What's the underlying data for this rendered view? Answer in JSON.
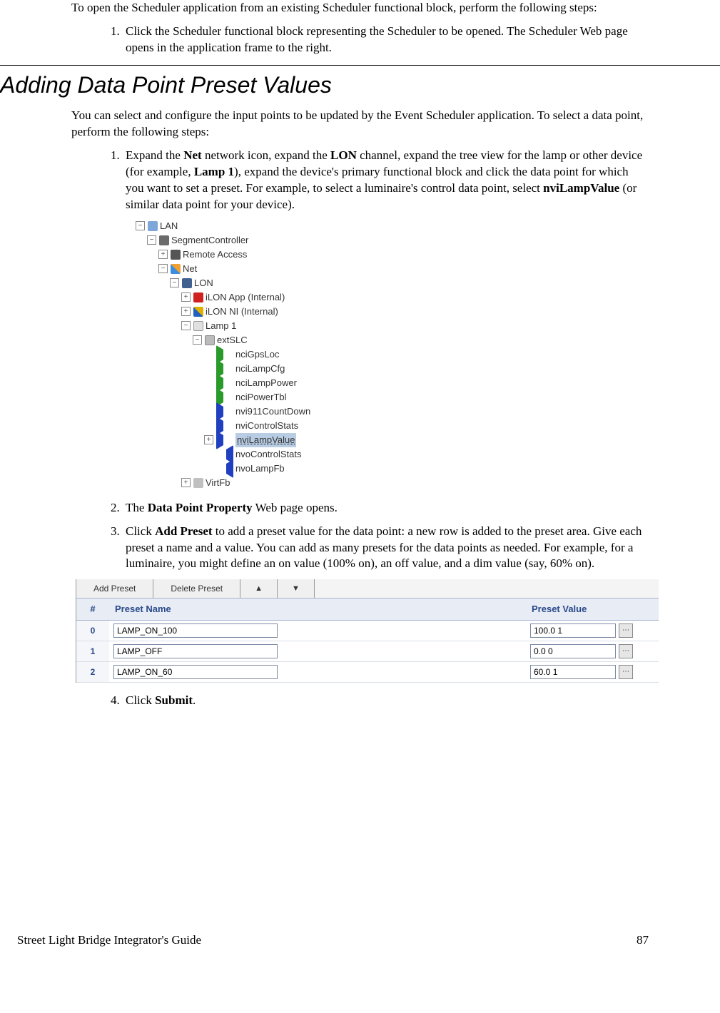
{
  "intro": {
    "p1": "To open the Scheduler application from an existing Scheduler functional block, perform the following steps:",
    "step1": "Click the Scheduler functional block representing the Scheduler to be opened.  The Scheduler Web page opens in the application frame to the right."
  },
  "section_title": "Adding Data Point Preset Values",
  "adding": {
    "p1": "You can select and configure the input points to be updated by the Event Scheduler application.  To select a data point, perform the following steps:",
    "step1": {
      "pre": "Expand the ",
      "b1": "Net",
      "mid1": " network icon, expand the ",
      "b2": "LON",
      "mid2": " channel, expand the tree view for the lamp or other device (for example, ",
      "b3": "Lamp 1",
      "mid3": "), expand the device's primary functional block and click the data point for which you want to set a preset.  For example, to select a luminaire's control data point, select ",
      "b4": "nviLampValue",
      "post": " (or similar data point for your device)."
    },
    "step2": {
      "pre": "The ",
      "b": "Data Point Property",
      "post": " Web page opens."
    },
    "step3": {
      "pre": "Click ",
      "b": "Add Preset",
      "post": " to add a preset value for the data point:  a new row is added to the preset area.  Give each preset a name and a value.  You can add as many presets for the data points as needed.  For example, for a luminaire, you might define an on value (100% on), an off value, and a dim value (say, 60% on)."
    },
    "step4": {
      "pre": "Click ",
      "b": "Submit",
      "post": "."
    }
  },
  "tree": {
    "lan": "LAN",
    "seg": "SegmentController",
    "rem": "Remote Access",
    "net": "Net",
    "lon": "LON",
    "app": "iLON App (Internal)",
    "ni": "iLON NI (Internal)",
    "lamp": "Lamp 1",
    "ext": "extSLC",
    "pts": [
      {
        "n": "nciGpsLoc",
        "c": "nci"
      },
      {
        "n": "nciLampCfg",
        "c": "nci"
      },
      {
        "n": "nciLampPower",
        "c": "nci"
      },
      {
        "n": "nciPowerTbl",
        "c": "nci"
      },
      {
        "n": "nvi911CountDown",
        "c": "nvi"
      },
      {
        "n": "nviControlStats",
        "c": "nvi"
      },
      {
        "n": "nviLampValue",
        "c": "nvi",
        "sel": true,
        "pm": "+"
      },
      {
        "n": "nvoControlStats",
        "c": "nvo"
      },
      {
        "n": "nvoLampFb",
        "c": "nvo"
      }
    ],
    "virt": "VirtFb"
  },
  "preset": {
    "toolbar": {
      "add": "Add Preset",
      "del": "Delete Preset",
      "up": "▲",
      "down": "▼"
    },
    "headers": {
      "num": "#",
      "name": "Preset Name",
      "val": "Preset Value"
    },
    "rows": [
      {
        "idx": "0",
        "name": "LAMP_ON_100",
        "val": "100.0 1"
      },
      {
        "idx": "1",
        "name": "LAMP_OFF",
        "val": "0.0 0"
      },
      {
        "idx": "2",
        "name": "LAMP_ON_60",
        "val": "60.0 1"
      }
    ],
    "ellipsis": "⋯"
  },
  "footer": {
    "title": "Street Light Bridge Integrator's Guide",
    "page": "87"
  }
}
